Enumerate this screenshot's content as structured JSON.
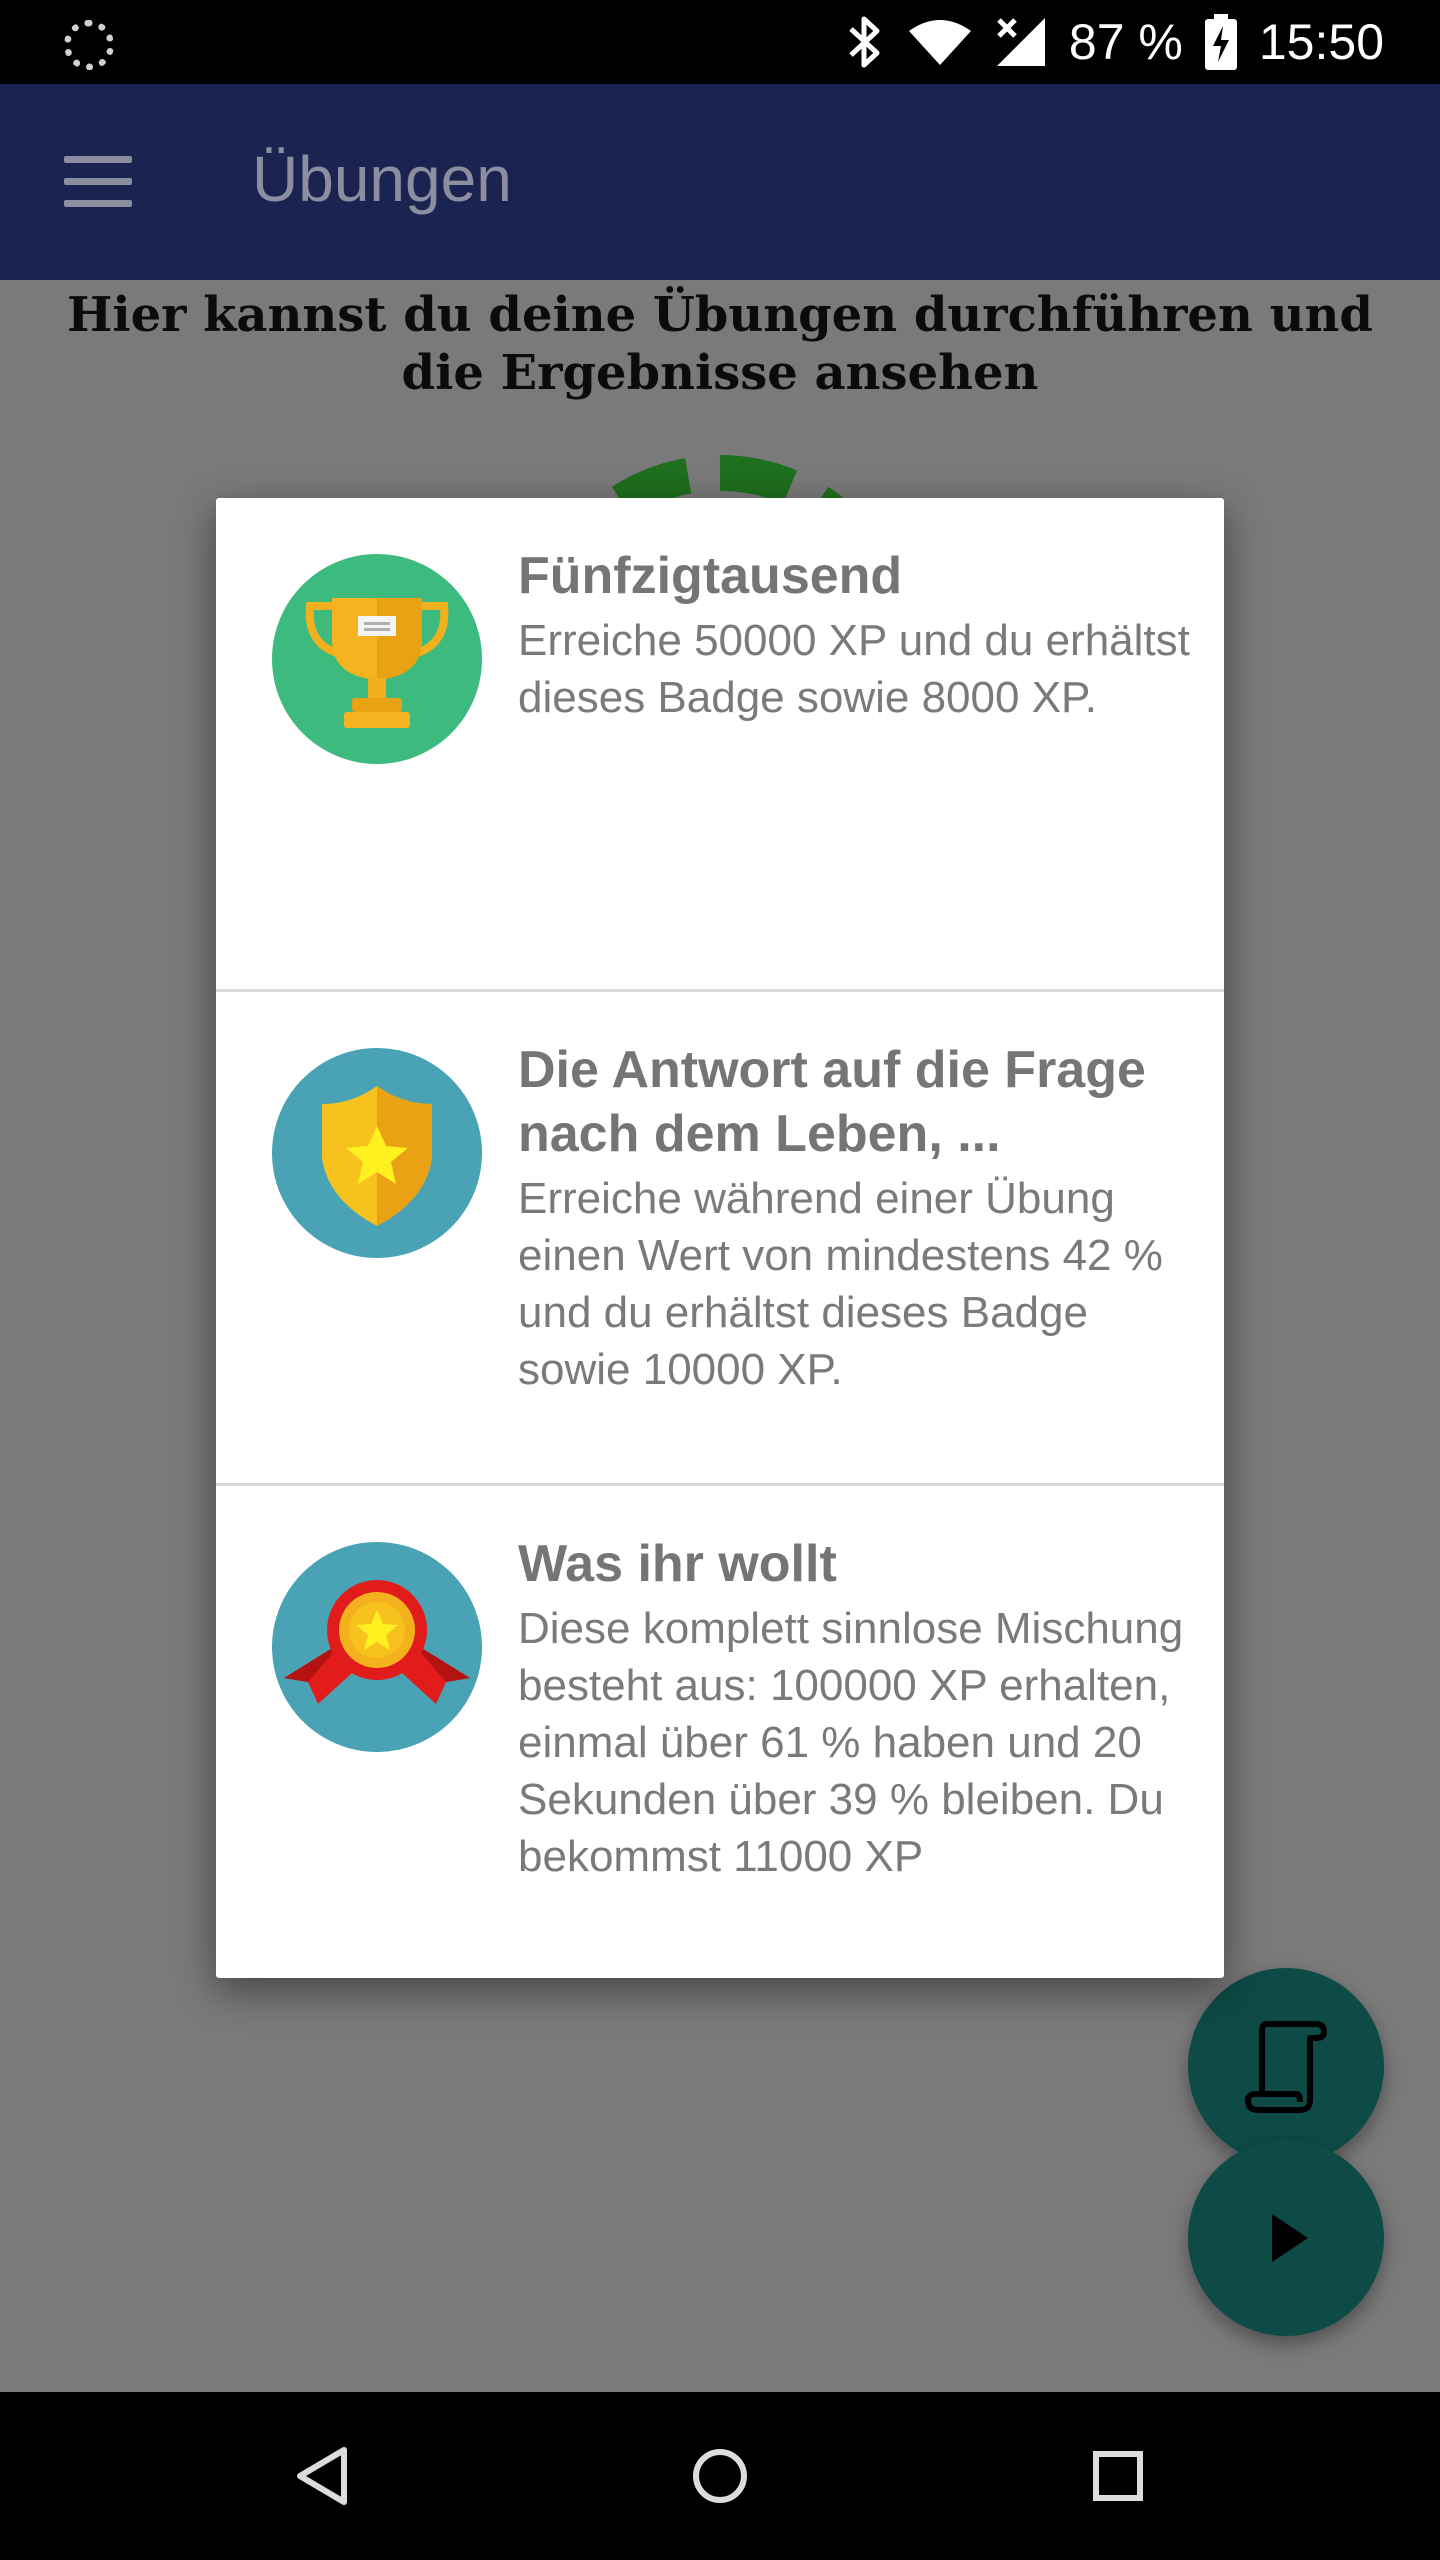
{
  "status_bar": {
    "battery": "87 %",
    "time": "15:50"
  },
  "app_bar": {
    "title": "Übungen"
  },
  "content": {
    "intro": "Hier kannst du deine Übungen durchführen und die Ergebnisse ansehen"
  },
  "dialog": {
    "badges": [
      {
        "title": "Fünfzigtausend",
        "description": "Erreiche 50000 XP und du erhältst dieses Badge sowie 8000 XP.",
        "icon": "trophy-icon",
        "circle_color": "#3dbb7e"
      },
      {
        "title": "Die Antwort auf die Frage nach dem Leben, ...",
        "description": "Erreiche während einer Übung einen Wert von mindestens 42 % und du erhältst dieses Badge sowie 10000 XP.",
        "icon": "shield-star-icon",
        "circle_color": "#4aa3b4"
      },
      {
        "title": "Was ihr wollt",
        "description": "Diese komplett sinnlose Mischung besteht aus: 100000 XP erhalten, einmal über 61 % haben und 20 Sekunden über 39 % bleiben. Du bekommst 11000 XP",
        "icon": "ribbon-medal-icon",
        "circle_color": "#4aa3b4"
      }
    ]
  },
  "colors": {
    "app_bar": "#1b2450",
    "fab": "#0e4a46",
    "scrim": "#7a7a7a"
  }
}
